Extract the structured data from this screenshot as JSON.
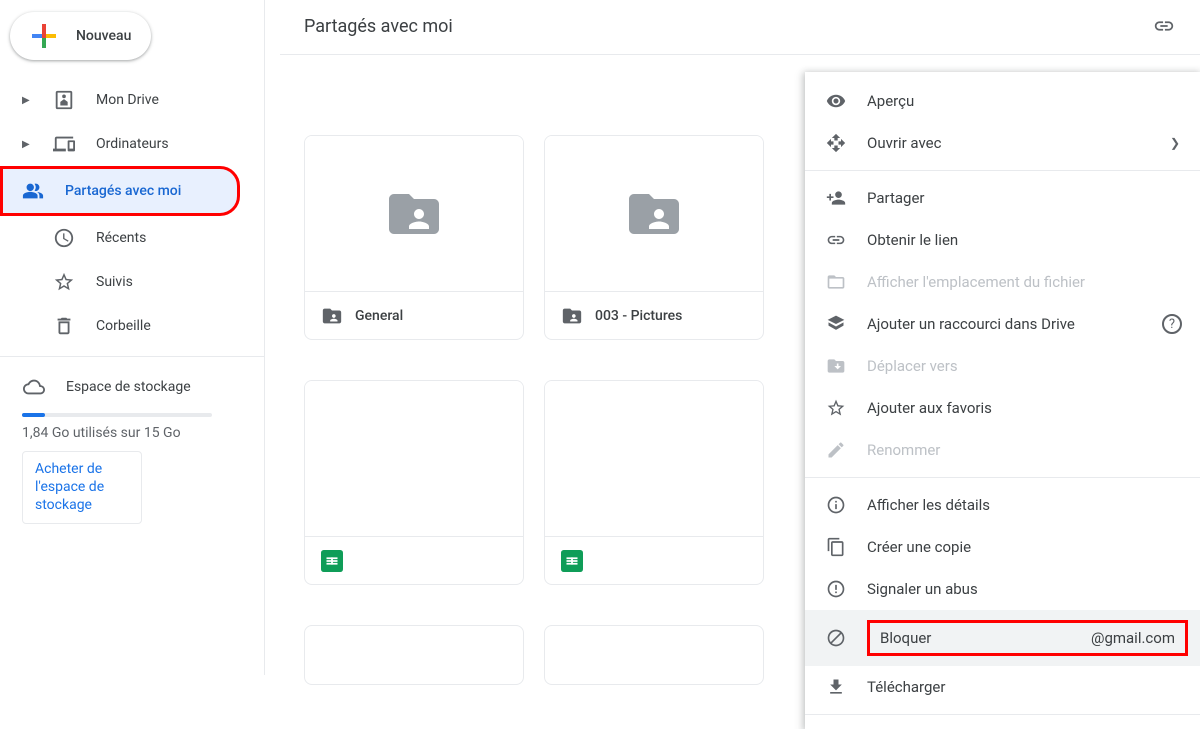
{
  "sidebar": {
    "new_label": "Nouveau",
    "items": [
      {
        "label": "Mon Drive",
        "icon": "drive"
      },
      {
        "label": "Ordinateurs",
        "icon": "devices"
      },
      {
        "label": "Partagés avec moi",
        "icon": "shared",
        "selected": true
      },
      {
        "label": "Récents",
        "icon": "recent"
      },
      {
        "label": "Suivis",
        "icon": "star"
      },
      {
        "label": "Corbeille",
        "icon": "trash"
      }
    ],
    "storage_label": "Espace de stockage",
    "storage_text": "1,84 Go utilisés sur 15 Go",
    "buy_storage_label": "Acheter de l'espace de stockage"
  },
  "page_title": "Partagés avec moi",
  "folders": [
    {
      "name": "General"
    },
    {
      "name": "003 - Pictures"
    }
  ],
  "context_menu": {
    "preview": "Aperçu",
    "open_with": "Ouvrir avec",
    "share": "Partager",
    "get_link": "Obtenir le lien",
    "show_location": "Afficher l'emplacement du fichier",
    "add_shortcut": "Ajouter un raccourci dans Drive",
    "move_to": "Déplacer vers",
    "add_favorites": "Ajouter aux favoris",
    "rename": "Renommer",
    "show_details": "Afficher les détails",
    "make_copy": "Créer une copie",
    "report_abuse": "Signaler un abus",
    "block_prefix": "Bloquer",
    "block_suffix": "@gmail.com",
    "download": "Télécharger"
  }
}
